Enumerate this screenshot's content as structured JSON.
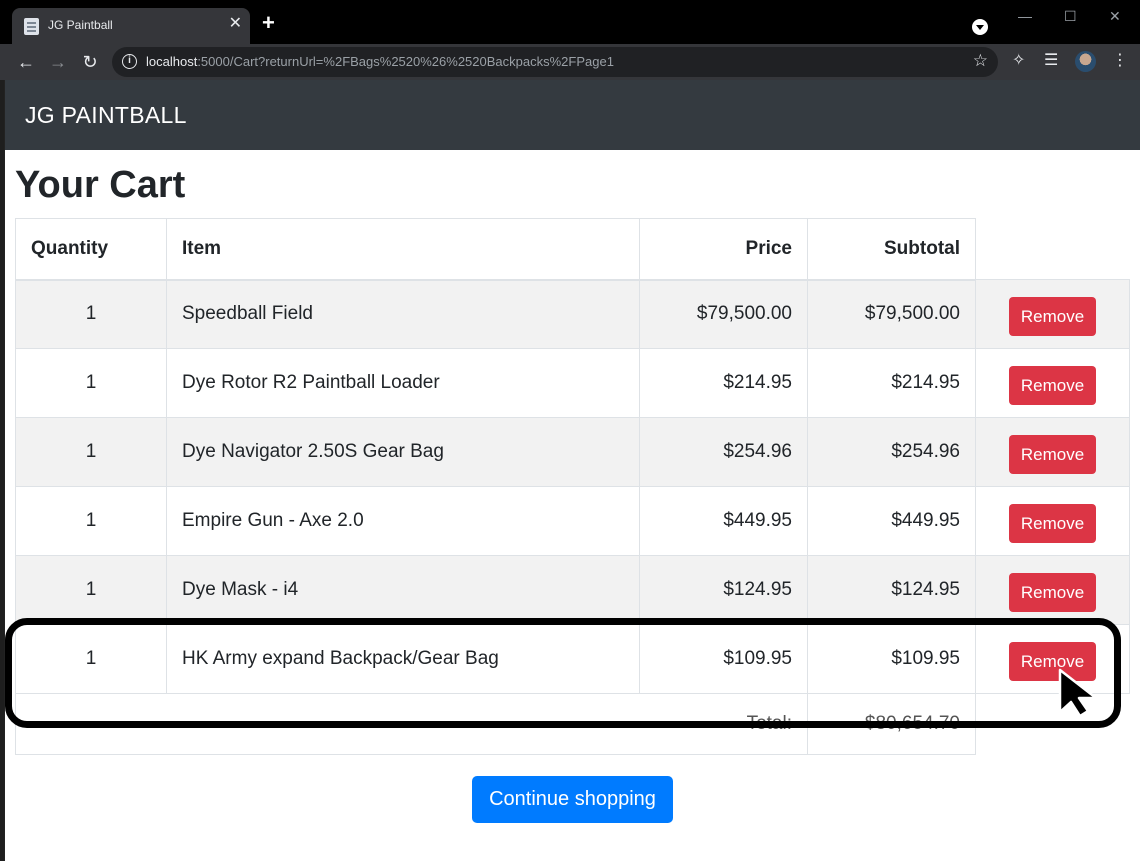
{
  "browser": {
    "tab_title": "JG Paintball",
    "tab_close": "✕",
    "new_tab": "+",
    "url_host": "localhost",
    "url_rest": ":5000/Cart?returnUrl=%2FBags%2520%26%2520Backpacks%2FPage1"
  },
  "navbar": {
    "brand": "JG PAINTBALL"
  },
  "page": {
    "heading": "Your Cart"
  },
  "table": {
    "headers": {
      "quantity": "Quantity",
      "item": "Item",
      "price": "Price",
      "subtotal": "Subtotal"
    },
    "rows": [
      {
        "quantity": "1",
        "item": "Speedball Field",
        "price": "$79,500.00",
        "subtotal": "$79,500.00",
        "action": "Remove"
      },
      {
        "quantity": "1",
        "item": "Dye Rotor R2 Paintball Loader",
        "price": "$214.95",
        "subtotal": "$214.95",
        "action": "Remove"
      },
      {
        "quantity": "1",
        "item": "Dye Navigator 2.50S Gear Bag",
        "price": "$254.96",
        "subtotal": "$254.96",
        "action": "Remove"
      },
      {
        "quantity": "1",
        "item": "Empire Gun - Axe 2.0",
        "price": "$449.95",
        "subtotal": "$449.95",
        "action": "Remove"
      },
      {
        "quantity": "1",
        "item": "Dye Mask - i4",
        "price": "$124.95",
        "subtotal": "$124.95",
        "action": "Remove"
      },
      {
        "quantity": "1",
        "item": "HK Army expand Backpack/Gear Bag",
        "price": "$109.95",
        "subtotal": "$109.95",
        "action": "Remove"
      }
    ],
    "total_label": "Total:",
    "total_value": "$80,654.70"
  },
  "actions": {
    "continue_label": "Continue shopping"
  },
  "colors": {
    "navbar": "#343a40",
    "remove": "#dc3545",
    "continue": "#007bff"
  },
  "icons": [
    "back-icon",
    "forward-icon",
    "reload-icon",
    "info-icon",
    "star-icon",
    "extensions-icon",
    "media-icon",
    "menu-icon",
    "cursor-icon"
  ]
}
